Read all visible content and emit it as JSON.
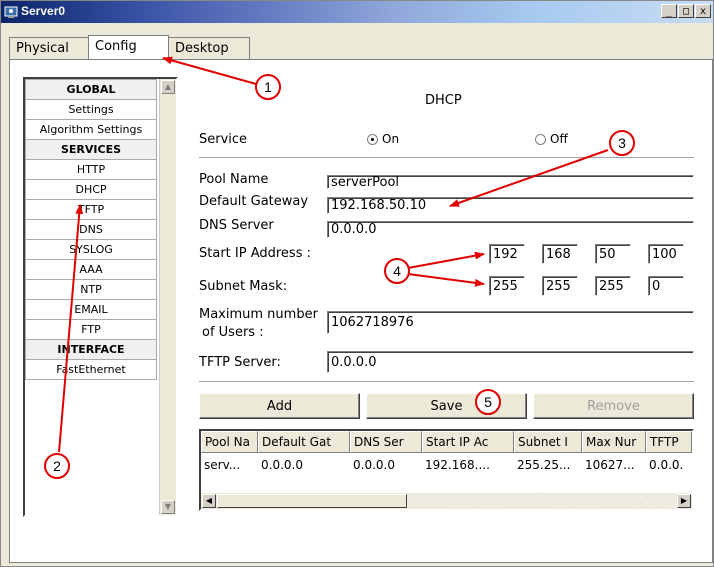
{
  "window": {
    "title": "Server0",
    "minimize": "_",
    "maximize": "□",
    "close": "x"
  },
  "tabs": [
    {
      "label": "Physical"
    },
    {
      "label": "Config"
    },
    {
      "label": "Desktop"
    }
  ],
  "sidebar": {
    "items": [
      {
        "label": "GLOBAL",
        "header": true
      },
      {
        "label": "Settings"
      },
      {
        "label": "Algorithm Settings"
      },
      {
        "label": "SERVICES",
        "header": true
      },
      {
        "label": "HTTP"
      },
      {
        "label": "DHCP"
      },
      {
        "label": "TFTP"
      },
      {
        "label": "DNS"
      },
      {
        "label": "SYSLOG"
      },
      {
        "label": "AAA"
      },
      {
        "label": "NTP"
      },
      {
        "label": "EMAIL"
      },
      {
        "label": "FTP"
      },
      {
        "label": "INTERFACE",
        "header": true
      },
      {
        "label": "FastEthernet"
      }
    ]
  },
  "dhcp": {
    "heading": "DHCP",
    "service_label": "Service",
    "on_label": "On",
    "off_label": "Off",
    "service_on": true,
    "pool_name_label": "Pool Name",
    "pool_name": "serverPool",
    "gateway_label": "Default Gateway",
    "gateway": "192.168.50.10",
    "dns_label": "DNS Server",
    "dns": "0.0.0.0",
    "start_ip_label": "Start IP Address :",
    "start_ip": [
      "192",
      "168",
      "50",
      "100"
    ],
    "subnet_label": "Subnet Mask:",
    "subnet": [
      "255",
      "255",
      "255",
      "0"
    ],
    "max_users_label_1": "Maximum number",
    "max_users_label_2": "of Users :",
    "max_users": "1062718976",
    "tftp_label": "TFTP Server:",
    "tftp": "0.0.0.0",
    "add_label": "Add",
    "save_label": "Save",
    "remove_label": "Remove"
  },
  "table": {
    "columns": [
      "Pool Na",
      "Default Gat",
      "DNS Ser",
      "Start IP Ac",
      "Subnet I",
      "Max Nur",
      "TFTP"
    ],
    "rows": [
      [
        "serv...",
        "0.0.0.0",
        "0.0.0.0",
        "192.168....",
        "255.25...",
        "10627...",
        "0.0.0."
      ]
    ]
  },
  "annotations": {
    "numbers": [
      "1",
      "2",
      "3",
      "4",
      "5"
    ],
    "color": "#e00000"
  }
}
